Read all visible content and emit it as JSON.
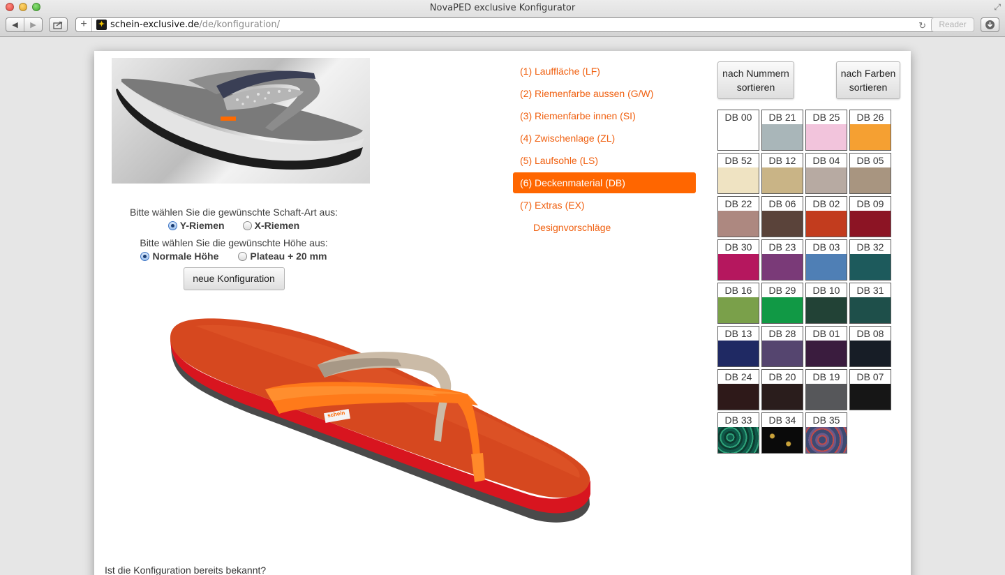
{
  "window": {
    "title": "NovaPED exclusive Konfigurator"
  },
  "address_bar": {
    "domain": "schein-exclusive.de",
    "path": "/de/konfiguration/",
    "reader_label": "Reader"
  },
  "configurator": {
    "shaft_prompt": "Bitte wählen Sie die gewünschte Schaft-Art aus:",
    "shaft_options": [
      {
        "label": "Y-Riemen",
        "selected": true
      },
      {
        "label": "X-Riemen",
        "selected": false
      }
    ],
    "height_prompt": "Bitte wählen Sie die gewünschte Höhe aus:",
    "height_options": [
      {
        "label": "Normale Höhe",
        "selected": true
      },
      {
        "label": "Plateau + 20 mm",
        "selected": false
      }
    ],
    "new_config_label": "neue Konfiguration",
    "known_prompt": "Ist die Konfiguration bereits bekannt?",
    "sandal_tag": "schein"
  },
  "menu": {
    "items": [
      {
        "label": "(1) Lauffläche (LF)",
        "active": false
      },
      {
        "label": "(2) Riemenfarbe aussen (G/W)",
        "active": false
      },
      {
        "label": "(3) Riemenfarbe innen (SI)",
        "active": false
      },
      {
        "label": "(4) Zwischenlage (ZL)",
        "active": false
      },
      {
        "label": "(5) Laufsohle (LS)",
        "active": false
      },
      {
        "label": "(6) Deckenmaterial (DB)",
        "active": true
      },
      {
        "label": "(7) Extras (EX)",
        "active": false
      },
      {
        "label": "Designvorschläge",
        "active": false
      }
    ],
    "accent": "#ff6600",
    "text_color": "#f06010"
  },
  "sort": {
    "by_number": "nach Nummern sortieren",
    "by_color": "nach Farben sortieren"
  },
  "swatches": [
    {
      "code": "DB 00",
      "color": "#ffffff"
    },
    {
      "code": "DB 21",
      "color": "#a9b6b9"
    },
    {
      "code": "DB 25",
      "color": "#f2c4dc"
    },
    {
      "code": "DB 26",
      "color": "#f5a032"
    },
    {
      "code": "DB 52",
      "color": "#efe3c2"
    },
    {
      "code": "DB 12",
      "color": "#c9b486"
    },
    {
      "code": "DB 04",
      "color": "#b7aaa2"
    },
    {
      "code": "DB 05",
      "color": "#a89580"
    },
    {
      "code": "DB 22",
      "color": "#ad8880"
    },
    {
      "code": "DB 06",
      "color": "#5a433a"
    },
    {
      "code": "DB 02",
      "color": "#c23c1e"
    },
    {
      "code": "DB 09",
      "color": "#8c1424"
    },
    {
      "code": "DB 30",
      "color": "#b5175e"
    },
    {
      "code": "DB 23",
      "color": "#7a3a78"
    },
    {
      "code": "DB 03",
      "color": "#4f7fb5"
    },
    {
      "code": "DB 32",
      "color": "#1d5a5c"
    },
    {
      "code": "DB 16",
      "color": "#7aa04a"
    },
    {
      "code": "DB 29",
      "color": "#119945"
    },
    {
      "code": "DB 10",
      "color": "#224236"
    },
    {
      "code": "DB 31",
      "color": "#1e4f4a"
    },
    {
      "code": "DB 13",
      "color": "#1f2963"
    },
    {
      "code": "DB 28",
      "color": "#55456f"
    },
    {
      "code": "DB 01",
      "color": "#3a1c3e"
    },
    {
      "code": "DB 08",
      "color": "#171d26"
    },
    {
      "code": "DB 24",
      "color": "#2e1919"
    },
    {
      "code": "DB 20",
      "color": "#2a1d1c"
    },
    {
      "code": "DB 19",
      "color": "#56575a"
    },
    {
      "code": "DB 07",
      "color": "#161616"
    },
    {
      "code": "DB 33",
      "color": "#0f5a4a"
    },
    {
      "code": "DB 34",
      "color": "#0a0a0a"
    },
    {
      "code": "DB 35",
      "color": "#3d4a72"
    }
  ]
}
